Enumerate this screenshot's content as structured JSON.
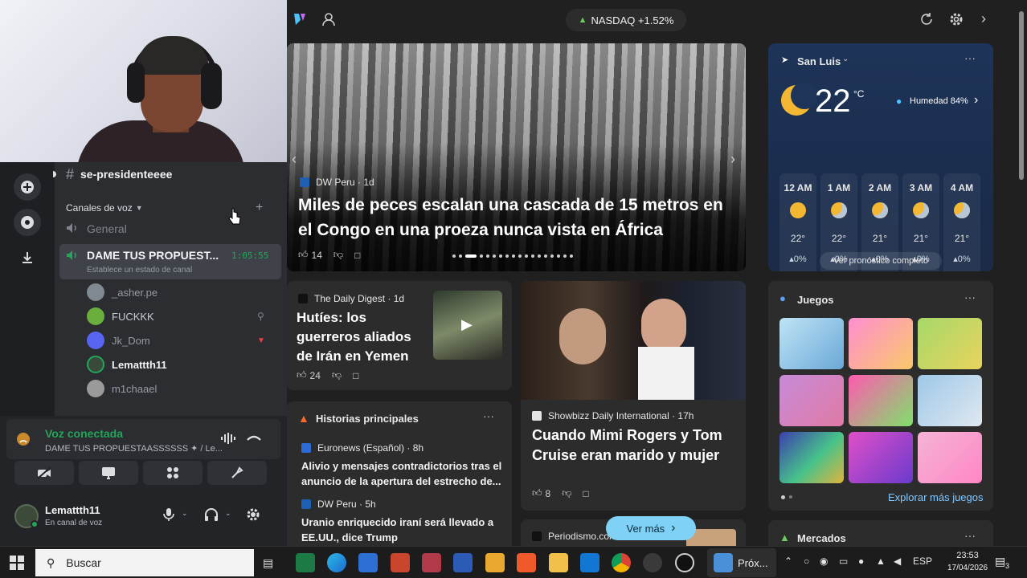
{
  "discord": {
    "channel_text": "se-presidenteeee",
    "voice_category": "Canales de voz",
    "channels": [
      {
        "name": "General"
      },
      {
        "name": "DAME TUS PROPUEST...",
        "time": "1:05:55",
        "status": "Establece un estado de canal"
      }
    ],
    "voice_users": [
      "_asher.pe",
      "FUCKKK",
      "Jk_Dom",
      "Lemattth11",
      "m1chaael"
    ],
    "voice_panel": {
      "title": "Voz conectada",
      "subtitle": "DAME TUS PROPUESTAASSSSSS ✦ / Le..."
    },
    "user": {
      "name": "Lemattth11",
      "status": "En canal de voz"
    }
  },
  "msn": {
    "ticker": "NASDAQ +1.52%",
    "hero": {
      "source": "DW Peru · 1d",
      "headline": "Miles de peces escalan una cascada de 15 metros en el Congo en una proeza nunca vista en África",
      "likes": "14"
    },
    "card_digest": {
      "source": "The Daily Digest · 1d",
      "headline": "Hutíes: los guerreros aliados de Irán en Yemen",
      "likes": "24"
    },
    "card_showbizz": {
      "source": "Showbizz Daily International · 17h",
      "headline": "Cuando Mimi Rogers y Tom Cruise eran marido y mujer",
      "likes": "8"
    },
    "top_stories": {
      "title": "Historias principales",
      "items": [
        {
          "source": "Euronews (Español) · 8h",
          "text": "Alivio y mensajes contradictorios tras el anuncio de la apertura del estrecho de..."
        },
        {
          "source": "DW Peru · 5h",
          "text": "Uranio enriquecido iraní será llevado a EE.UU., dice Trump"
        }
      ]
    },
    "bottom_card_source": "Periodismo.com",
    "see_more": "Ver más",
    "weather": {
      "location": "San Luis",
      "temp": "22",
      "unit": "°C",
      "humidity": "Humedad 84%",
      "hours": [
        {
          "time": "12 AM",
          "temp": "22°",
          "rain": "▴0%"
        },
        {
          "time": "1 AM",
          "temp": "22°",
          "rain": "▴0%"
        },
        {
          "time": "2 AM",
          "temp": "21°",
          "rain": "▴0%"
        },
        {
          "time": "3 AM",
          "temp": "21°",
          "rain": "▴0%"
        },
        {
          "time": "4 AM",
          "temp": "21°",
          "rain": "▴0%"
        }
      ],
      "forecast_link": "Ver pronóstico completo"
    },
    "games": {
      "title": "Juegos",
      "explore": "Explorar más juegos"
    },
    "markets": {
      "title": "Mercados"
    }
  },
  "taskbar": {
    "search_placeholder": "Buscar",
    "active_app": "Próx...",
    "lang": "ESP",
    "time": "23:53",
    "date": "17/04/2026",
    "notif_count": "3"
  },
  "colors": {
    "discord_green": "#23a55a",
    "msn_accent": "#4cc2ff",
    "weather_bg": "#1e3458"
  }
}
